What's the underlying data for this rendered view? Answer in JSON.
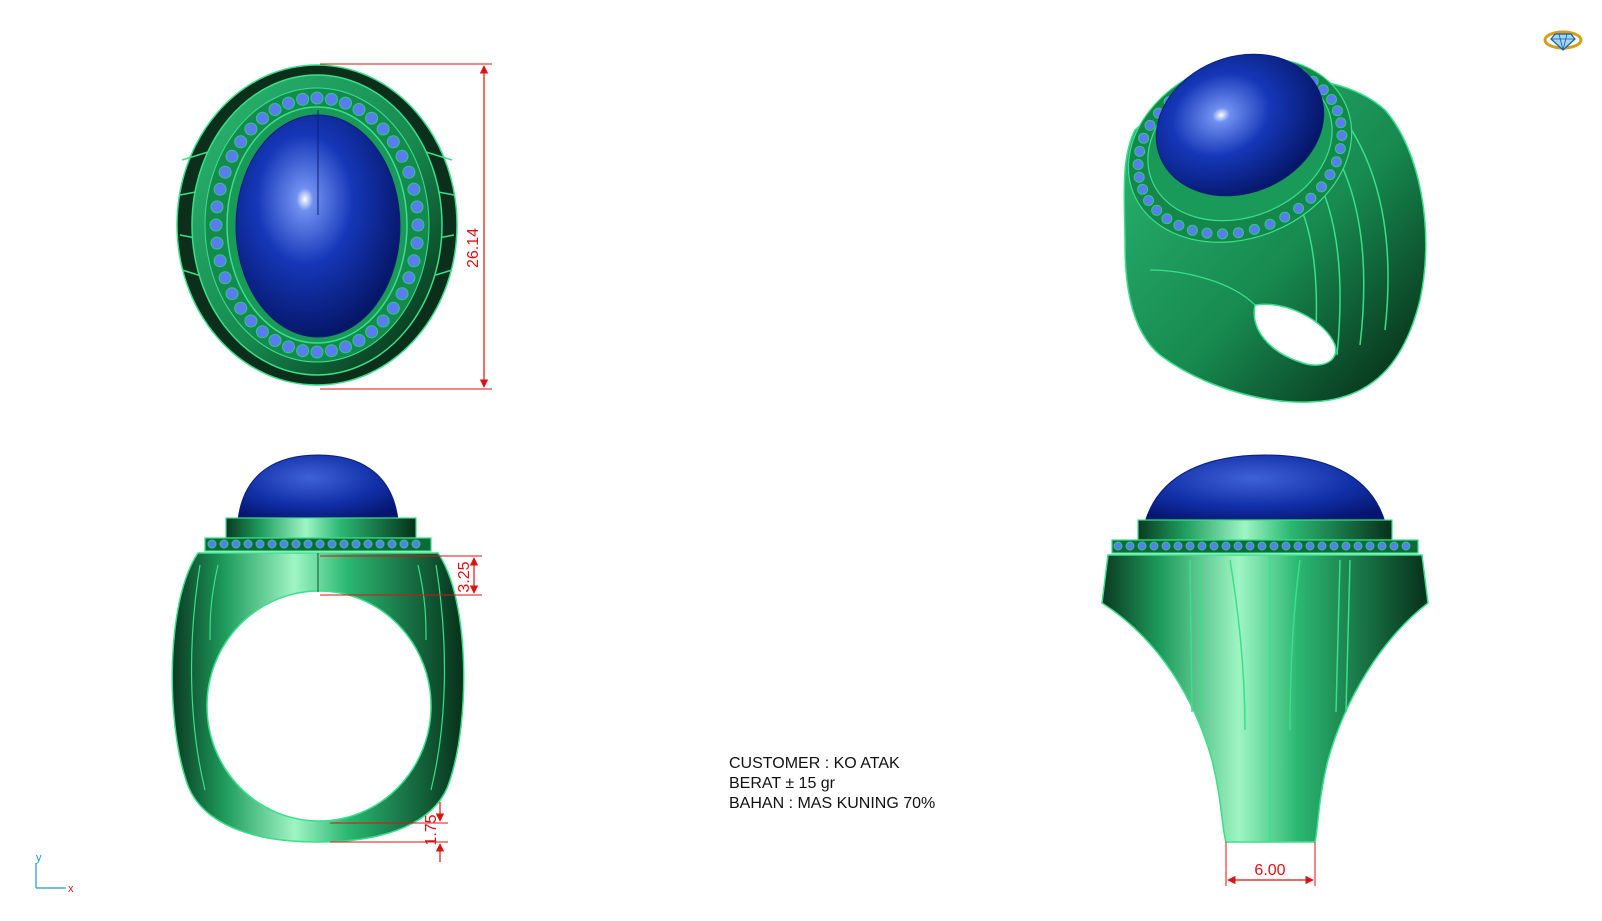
{
  "dimensions": {
    "top_height": "26.14",
    "shoulder_height": "3.25",
    "shank_bottom": "1.75",
    "shank_width": "6.00"
  },
  "info": {
    "customer": "CUSTOMER : KO ATAK",
    "weight": "BERAT ± 15 gr",
    "material": "BAHAN : MAS KUNING 70%"
  },
  "axes": {
    "y": "y",
    "x": "x"
  },
  "colors": {
    "metal": "#1e9c5c",
    "metal_edge": "#39e08a",
    "stone": "#0c2a9a",
    "accent_stones": "#5a7cf0",
    "dimension": "#e01010"
  },
  "logo_icon": "diamond-ring-icon"
}
